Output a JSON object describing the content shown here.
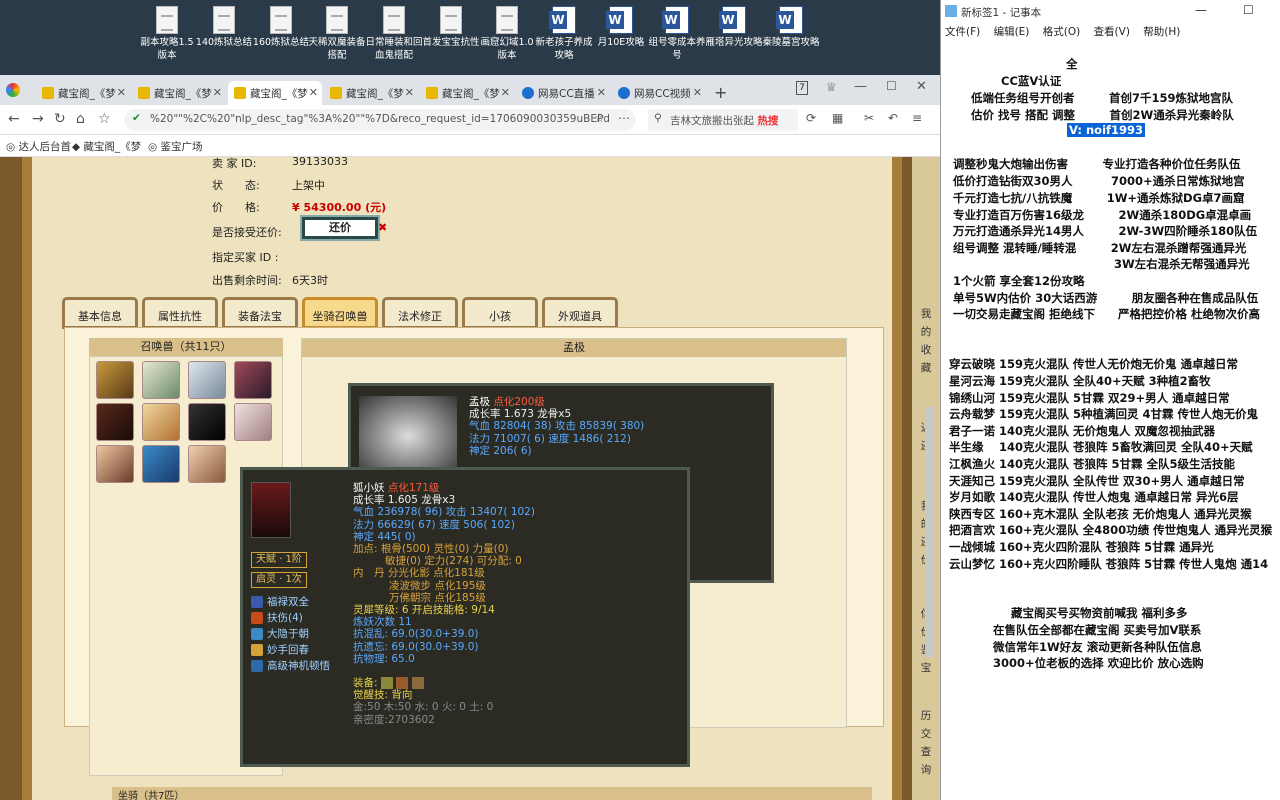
{
  "desktop": {
    "icons": [
      {
        "label": "副本攻略1.5版本",
        "kind": "file"
      },
      {
        "label": "140炼狱总结",
        "kind": "file"
      },
      {
        "label": "160炼狱总结",
        "kind": "file"
      },
      {
        "label": "天稀双魔装备搭配",
        "kind": "file"
      },
      {
        "label": "日常睡装和回血鬼搭配",
        "kind": "file"
      },
      {
        "label": "首发宝宝抗性",
        "kind": "file"
      },
      {
        "label": "画窟幻域1.0版本",
        "kind": "file"
      },
      {
        "label": "新老孩子养成攻略",
        "kind": "word"
      },
      {
        "label": "月10E攻略",
        "kind": "word"
      },
      {
        "label": "组号零成本养号",
        "kind": "word"
      },
      {
        "label": "雁塔异光攻略",
        "kind": "word"
      },
      {
        "label": "秦陵墓宫攻略",
        "kind": "word"
      }
    ]
  },
  "browser": {
    "tabs": [
      {
        "label": "藏宝阁_《梦",
        "active": false,
        "icon": "treasure-icon"
      },
      {
        "label": "藏宝阁_《梦",
        "active": false,
        "icon": "treasure-icon"
      },
      {
        "label": "藏宝阁_《梦",
        "active": true,
        "icon": "treasure-icon"
      },
      {
        "label": "藏宝阁_《梦",
        "active": false,
        "icon": "treasure-icon"
      },
      {
        "label": "藏宝阁_《梦",
        "active": false,
        "icon": "treasure-icon"
      },
      {
        "label": "网易CC直播",
        "active": false,
        "icon": "cc-icon"
      },
      {
        "label": "网易CC视频",
        "active": false,
        "icon": "cc-icon"
      }
    ],
    "tab_count": "7",
    "url": "%20\"\"%2C%20\"nlp_desc_tag\"%3A%20\"\"%7D&reco_request_id=1706090030359uBEPd",
    "search_text": "吉林文旅搬出张起",
    "search_hot": "热搜",
    "bookmarks": [
      "达人后台首",
      "藏宝阁_《梦",
      "鉴宝广场"
    ]
  },
  "listing": {
    "seller_label": "卖 家 ID:",
    "seller_value": "39133033",
    "status_label": "状　　态:",
    "status_value": "上架中",
    "price_label": "价　　格:",
    "price_value": "¥ 54300.00 (元)",
    "counter_label": "是否接受还价:",
    "counter_button": "还价",
    "buyer_label": "指定买家 ID :",
    "buyer_value": "",
    "time_label": "出售剩余时间:",
    "time_value": "6天3时"
  },
  "tabs": [
    "基本信息",
    "属性抗性",
    "装备法宝",
    "坐骑召唤兽",
    "法术修正",
    "小孩",
    "外观道具"
  ],
  "active_tab": "坐骑召唤兽",
  "pet_list_title": "召唤兽（共11只）",
  "right_panel_title": "孟极",
  "mount_tip": {
    "name": "孟极",
    "tag": "点化200级",
    "line1": "成长率 1.673  龙骨x5",
    "line2": "气血 82804( 38)  攻击 85839( 380)",
    "line3": "法力 71007( 6)  速度 1486( 212)",
    "line4": "神定 206( 6)"
  },
  "pet_tip": {
    "name": "狐小妖",
    "tag": "点化171级",
    "growth": "成长率 1.605  龙骨x3",
    "hp": "气血 236978( 96)  攻击 13407( 102)",
    "mp": "法力 66629( 67)  速度 506( 102)",
    "shen": "神定 445( 0)",
    "addpts1": "加点:  根骨(500) 灵性(0) 力量(0)",
    "addpts2": "敏捷(0) 定力(274) 可分配:  0",
    "neidan1": "内　丹  分光化影 点化181级",
    "neidan2": "凌波微步 点化195级",
    "neidan3": "万佛朝宗 点化185级",
    "spirit": "灵犀等级:  6  开启技能格:  9/14",
    "refine": "炼妖次数 11",
    "res1": "抗混乱: 69.0(30.0+39.0)",
    "res2": "抗遗忘: 69.0(30.0+39.0)",
    "res3": "抗物理: 65.0",
    "equip_label": "装备:",
    "awaken_label": "觉醒技:",
    "awaken_value": "背向",
    "elements": "金:50  木:50  水: 0  火: 0  土: 0",
    "intimacy": "亲密度:2703602",
    "talent": "天赋 · 1阶",
    "qiling": "启灵 · 1次",
    "skills": [
      "福禄双全",
      "扶伤(4)",
      "大隐于朝",
      "妙手回春",
      "高级神机顿悟"
    ]
  },
  "side_strip": [
    "我",
    "的",
    "收",
    "藏",
    "近",
    "还",
    "我",
    "的",
    "还",
    "价",
    "估",
    "价",
    "鉴",
    "宝",
    "历",
    "交",
    "查",
    "询"
  ],
  "bottom_tab_title": "坐骑（共7匹）",
  "notepad": {
    "title": "新标签1 - 记事本",
    "menu": [
      "文件(F)",
      "编辑(E)",
      "格式(O)",
      "查看(V)",
      "帮助(H)"
    ],
    "lines": [
      "全　　　　　　　　　　　　　　　　",
      "CC蓝V认证　　　　　　　　　　　　",
      "低端任务组号开创者　　　首创7千159炼狱地宫队",
      "估价 找号 搭配 调整　　　首创2W通杀异光秦岭队",
      "V:  noif1993",
      "调整秒鬼大炮输出伤害　　　专业打造各种价位任务队伍",
      "低价打造钻街双30男人　　　 7000+通杀日常炼狱地宫",
      "千元打造七抗/八抗铁魔　　　1W+通杀炼狱DG卓7画窟",
      "专业打造百万伤害16级龙　　　2W通杀180DG卓混卓画",
      "万元打造通杀异光14男人　　　2W-3W四阶睡杀180队伍",
      "组号调整 混转睡/睡转混　　　2W左右混杀蹭帮强通异光",
      "　　　　　　　　　　　　　　3W左右混杀无帮强通异光",
      "1个火箭 享全套12份攻略",
      "单号5W内估价 30大话西游　　　朋友圈各种在售成品队伍",
      "一切交易走藏宝阁 拒绝线下　　严格把控价格 杜绝物次价高",
      "穿云破晓 159克火混队 传世人无价炮无价鬼 通卓越日常",
      "星河云海 159克火混队 全队40+天赋 3种植2畜牧",
      "锦绣山河 159克火混队 5甘霖 双29+男人 通卓越日常",
      "云舟载梦 159克火混队 5种植满回灵 4甘霖 传世人炮无价鬼",
      "君子一诺 140克火混队 无价炮鬼人 双魔忽视抽武器",
      "半生缘　 140克火混队 苍狼阵 5畜牧满回灵 全队40+天赋",
      "江枫渔火 140克火混队 苍狼阵 5甘霖 全队5级生活技能",
      "天涯知己 159克火混队 全队传世 双30+男人 通卓越日常",
      "岁月如歌 140克火混队 传世人炮鬼 通卓越日常 异光6层",
      "陕西专区 160+克木混队 全队老孩 无价炮鬼人 通异光灵猴",
      "把酒言欢 160+克火混队 全4800功绩 传世炮鬼人 通异光灵猴",
      "一战倾城 160+克火四阶混队 苍狼阵 5甘霖 通异光",
      "云山梦忆 160+克火四阶睡队 苍狼阵 5甘霖 传世人鬼炮 通14",
      "藏宝阁买号买物资前喊我 福利多多",
      "在售队伍全部都在藏宝阁 买卖号加V联系",
      "微信常年1W好友 滚动更新各种队伍信息",
      "3000+位老板的选择 欢迎比价 放心选购"
    ]
  },
  "colors": {
    "price": "#cc0000",
    "notepad_highlight": "#0a64d6",
    "frame": "#a87c3c",
    "tab_active": "#f7d98d"
  }
}
